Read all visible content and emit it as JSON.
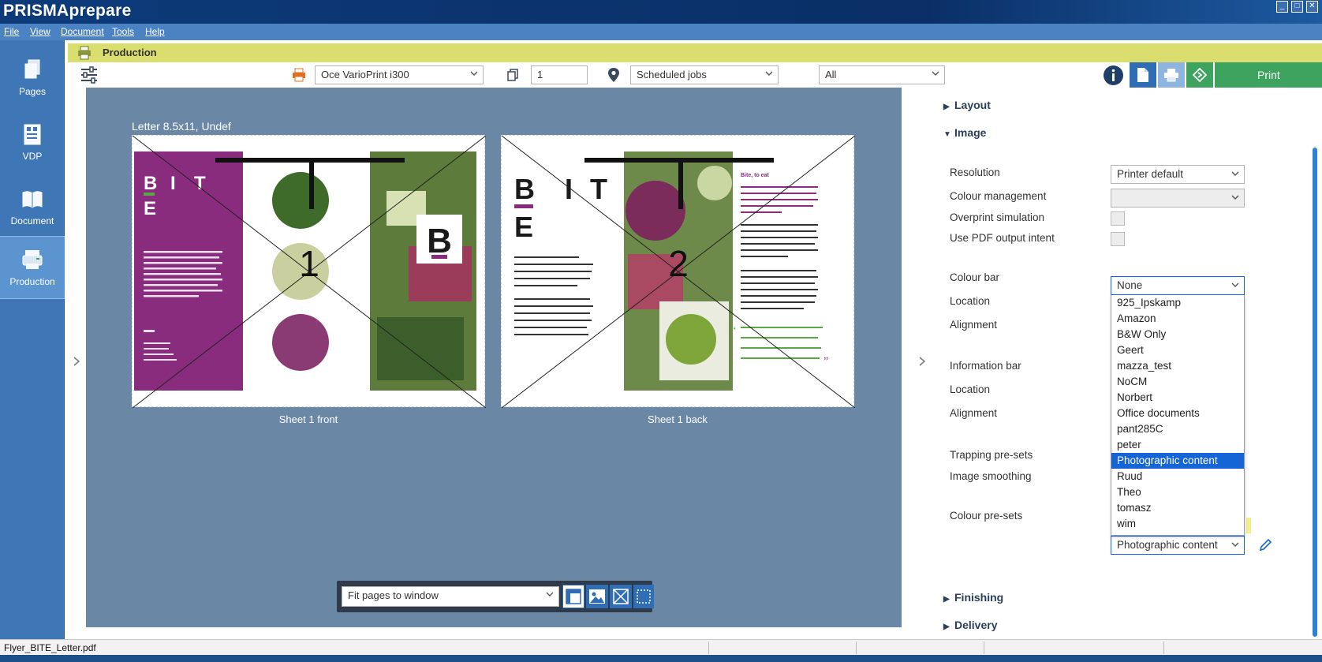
{
  "window": {
    "title": "PRISMAprepare"
  },
  "menu": [
    {
      "label": "File"
    },
    {
      "label": "View"
    },
    {
      "label": "Document"
    },
    {
      "label": "Tools"
    },
    {
      "label": "Help"
    }
  ],
  "nav": {
    "items": [
      {
        "label": "Pages",
        "icon": "pages-icon",
        "active": false
      },
      {
        "label": "VDP",
        "icon": "vdp-icon",
        "active": false
      },
      {
        "label": "Document",
        "icon": "document-icon",
        "active": false
      },
      {
        "label": "Production",
        "icon": "production-icon",
        "active": true
      }
    ]
  },
  "production_header": {
    "title": "Production"
  },
  "toolbar": {
    "printer": "Oce VarioPrint i300",
    "copies": "1",
    "destination": "Scheduled jobs",
    "filter": "All",
    "print_label": "Print"
  },
  "preview": {
    "paper": "Letter 8.5x11, Undef",
    "sheets": [
      {
        "label": "Sheet 1 front",
        "page_number": "1"
      },
      {
        "label": "Sheet 1 back",
        "page_number": "2"
      }
    ],
    "fit_option": "Fit pages to window",
    "flyer": {
      "brand_letters": [
        "B",
        "I",
        "T",
        "E"
      ],
      "logo_letter": "B",
      "front_text": "Need we say more? An exquisite menu offering a distinctive variety of home made favorites and innovative and surprising new selections. Combined with a personalized service, we're bringing the attention to detail to a whole new level, making Bite a premier catering service you can trust. Check out our website to find out how we can help you in your catering needs.",
      "front_contact": [
        "www.bite.biz",
        "info@bite.biz",
        "1837 19th Street",
        "Chicago, IL 65623"
      ],
      "back_intro_1": "Bite is all you need to know. We are here for all your catering needs. Ranging from small venues and get-togethers, to weddings, meetings and gala events.",
      "back_intro_2": "Our catering service is something personal, an event needs your touch in ambiance but also in food. Perfectly tailored to your needs and budget, with a special kind of personal attention to detail.",
      "back_heading": "Bite, to eat",
      "back_purple": "Bite is where people go when they want the most exquisite menu selections and event services for their guests. There is no event too big or too small. They're all uniquely special to us.",
      "back_para_1": "Wether it's an informal meeting, a birthday party, a gathering of friends and family, a wedding day or even a gala event, Bite will be there providing our well known high level of service and superb menu selections.",
      "back_para_2": "Great food, a complete menu ranging from all time favorites with innovative new dishes. Outstanding service from our top rated personel. A full line bar and beverage services with our finest wines from and beers, specially selected to go best by the food served.",
      "quote": "The food was absolutely amazing, I received so many compliments on how everything tasted!"
    }
  },
  "panel": {
    "sections": {
      "layout": "Layout",
      "image": "Image",
      "finishing": "Finishing",
      "delivery": "Delivery"
    },
    "rows": {
      "resolution": {
        "label": "Resolution",
        "value": "Printer default"
      },
      "colour_management": {
        "label": "Colour management",
        "value": ""
      },
      "overprint": {
        "label": "Overprint simulation"
      },
      "pdf_intent": {
        "label": "Use PDF output intent"
      },
      "colour_bar": {
        "label": "Colour bar",
        "value": "None"
      },
      "colour_bar_location": {
        "label": "Location"
      },
      "colour_bar_alignment": {
        "label": "Alignment"
      },
      "information_bar": {
        "label": "Information bar"
      },
      "info_location": {
        "label": "Location"
      },
      "info_alignment": {
        "label": "Alignment"
      },
      "trapping": {
        "label": "Trapping pre-sets"
      },
      "smoothing": {
        "label": "Image smoothing"
      },
      "colour_presets": {
        "label": "Colour pre-sets",
        "value": "Photographic content"
      }
    },
    "dropdown_options": [
      "925_Ipskamp",
      "Amazon",
      "B&W Only",
      "Geert",
      "mazza_test",
      "NoCM",
      "Norbert",
      "Office documents",
      "pant285C",
      "peter",
      "Photographic content",
      "Ruud",
      "Theo",
      "tomasz",
      "wim"
    ],
    "dropdown_selected": "Photographic content"
  },
  "statusbar": {
    "file": "Flyer_BITE_Letter.pdf"
  },
  "colors": {
    "titlebar": "#0d3b7a",
    "menubar": "#4a82c2",
    "nav": "#3f77b6",
    "production_header": "#d9de6f",
    "canvas": "#6b87a6",
    "print_button": "#3da35f",
    "accent": "#1565d6",
    "flyer_purple": "#8a2c7d",
    "flyer_green": "#5aa844"
  }
}
